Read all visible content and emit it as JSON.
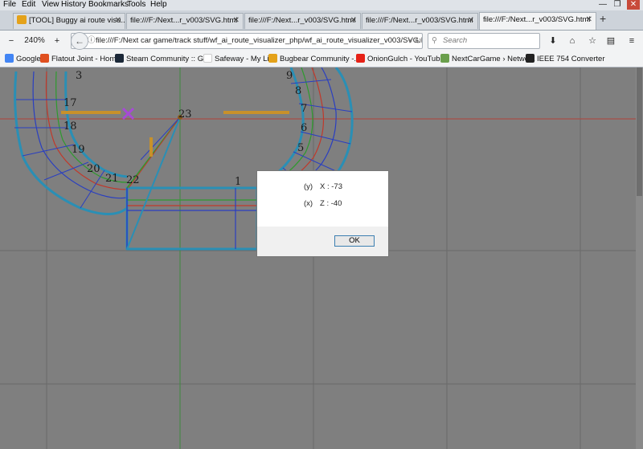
{
  "menubar": {
    "items": [
      "File",
      "Edit",
      "View",
      "History",
      "Bookmarks",
      "Tools",
      "Help"
    ]
  },
  "window_controls": {
    "minimize": "—",
    "restore": "❐",
    "close": "✕"
  },
  "tabs": [
    {
      "label": "[TOOL] Buggy ai route visu...",
      "active": false
    },
    {
      "label": "file:///F:/Next...r_v003/SVG.html",
      "active": false
    },
    {
      "label": "file:///F:/Next...r_v003/SVG.html",
      "active": false
    },
    {
      "label": "file:///F:/Next...r_v003/SVG.html",
      "active": false
    },
    {
      "label": "file:///F:/Next...r_v003/SVG.html",
      "active": true
    }
  ],
  "navbar": {
    "zoom_out": "−",
    "zoom_level": "240%",
    "zoom_in": "+",
    "url": "file:///F:/Next car game/track stuff/wf_ai_route_visualizer_php/wf_ai_route_visualizer_v003/SVG.html",
    "search_placeholder": "Search"
  },
  "bookmarks": [
    {
      "label": "Google",
      "color": "#4285f4"
    },
    {
      "label": "Flatout Joint - Home",
      "color": "#e05020"
    },
    {
      "label": "Steam Community :: G...",
      "color": "#1b2838"
    },
    {
      "label": "Safeway - My List",
      "color": "#ffffff"
    },
    {
      "label": "Bugbear Community -...",
      "color": "#e4a21a"
    },
    {
      "label": "OnionGulch - YouTube",
      "color": "#e62117"
    },
    {
      "label": "NextCarGame › Netwo...",
      "color": "#6a9f4c"
    },
    {
      "label": "IEEE 754 Converter",
      "color": "#222222"
    }
  ],
  "visualizer": {
    "node_labels": [
      "17",
      "18",
      "19",
      "20",
      "21",
      "22",
      "23",
      "7",
      "6",
      "5",
      "8",
      "9",
      "1",
      "3"
    ],
    "colors": {
      "outer": "#2a8fb5",
      "red": "#c0392b",
      "green": "#2e9a2e",
      "blue": "#2a3fc0",
      "marker": "#a74ad6",
      "bar": "#c8912a"
    }
  },
  "dialog": {
    "line1_prefix": "(y)",
    "line1_text": "X : -73",
    "line2_prefix": "(x)",
    "line2_text": "Z : -40",
    "ok_label": "OK"
  }
}
